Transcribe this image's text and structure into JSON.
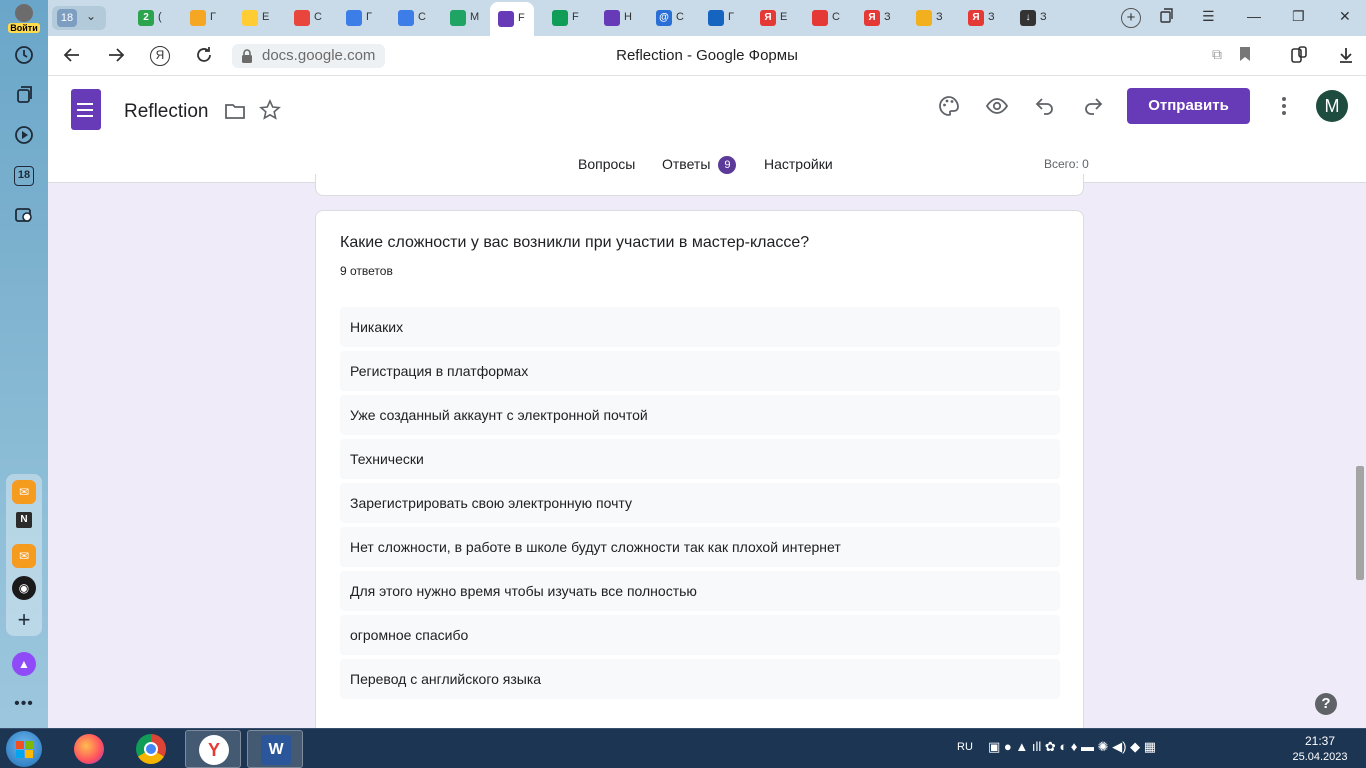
{
  "sidebar": {
    "login_label": "Войти",
    "calendar_day": "18"
  },
  "browser": {
    "tab_group_count": "18",
    "tabs": [
      {
        "fav_color": "#2ca44e",
        "fav_text": "2",
        "label": "("
      },
      {
        "fav_color": "#f5a623",
        "fav_text": "",
        "label": "Г"
      },
      {
        "fav_color": "#ffcc33",
        "fav_text": "",
        "label": "Е"
      },
      {
        "fav_color": "#e8453c",
        "fav_text": "",
        "label": "С"
      },
      {
        "fav_color": "#3d7de8",
        "fav_text": "",
        "label": "Г"
      },
      {
        "fav_color": "#3d7de8",
        "fav_text": "",
        "label": "С"
      },
      {
        "fav_color": "#1fa463",
        "fav_text": "",
        "label": "М"
      },
      {
        "fav_color": "#673ab7",
        "fav_text": "",
        "label": "F",
        "active": true
      },
      {
        "fav_color": "#0f9d58",
        "fav_text": "",
        "label": "F"
      },
      {
        "fav_color": "#673ab7",
        "fav_text": "",
        "label": "Н"
      },
      {
        "fav_color": "#2a6fd6",
        "fav_text": "@",
        "label": "С"
      },
      {
        "fav_color": "#1565c0",
        "fav_text": "",
        "label": "Г"
      },
      {
        "fav_color": "#e53935",
        "fav_text": "Я",
        "label": "Е"
      },
      {
        "fav_color": "#e53935",
        "fav_text": "",
        "label": "С"
      },
      {
        "fav_color": "#e53935",
        "fav_text": "Я",
        "label": "З"
      },
      {
        "fav_color": "#f2b01e",
        "fav_text": "",
        "label": "З"
      },
      {
        "fav_color": "#e53935",
        "fav_text": "Я",
        "label": "З"
      },
      {
        "fav_color": "#333333",
        "fav_text": "↓",
        "label": "З"
      }
    ],
    "url": "docs.google.com",
    "page_title": "Reflection - Google Формы"
  },
  "form": {
    "title": "Reflection",
    "send_label": "Отправить",
    "avatar_letter": "М",
    "tabs": {
      "questions": "Вопросы",
      "responses": "Ответы",
      "responses_count": "9",
      "settings": "Настройки"
    },
    "total_label": "Всего: 0"
  },
  "question": {
    "title": "Какие сложности у вас возникли при участии в мастер-классе?",
    "count_label": "9 ответов",
    "answers": [
      "Никаких",
      "Регистрация в платформах",
      "Уже созданный аккаунт с электронной почтой",
      "Технически",
      "Зарегистрировать свою электронную почту",
      "Нет сложности, в работе в школе будут сложности так как плохой интернет",
      "Для этого нужно время чтобы изучать все полностью",
      "огромное спасибо",
      "Перевод с английского языка"
    ]
  },
  "taskbar": {
    "lang": "RU",
    "time": "21:37",
    "date": "25.04.2023"
  },
  "colors": {
    "accent": "#673ab7",
    "background": "#f0ebf8"
  }
}
